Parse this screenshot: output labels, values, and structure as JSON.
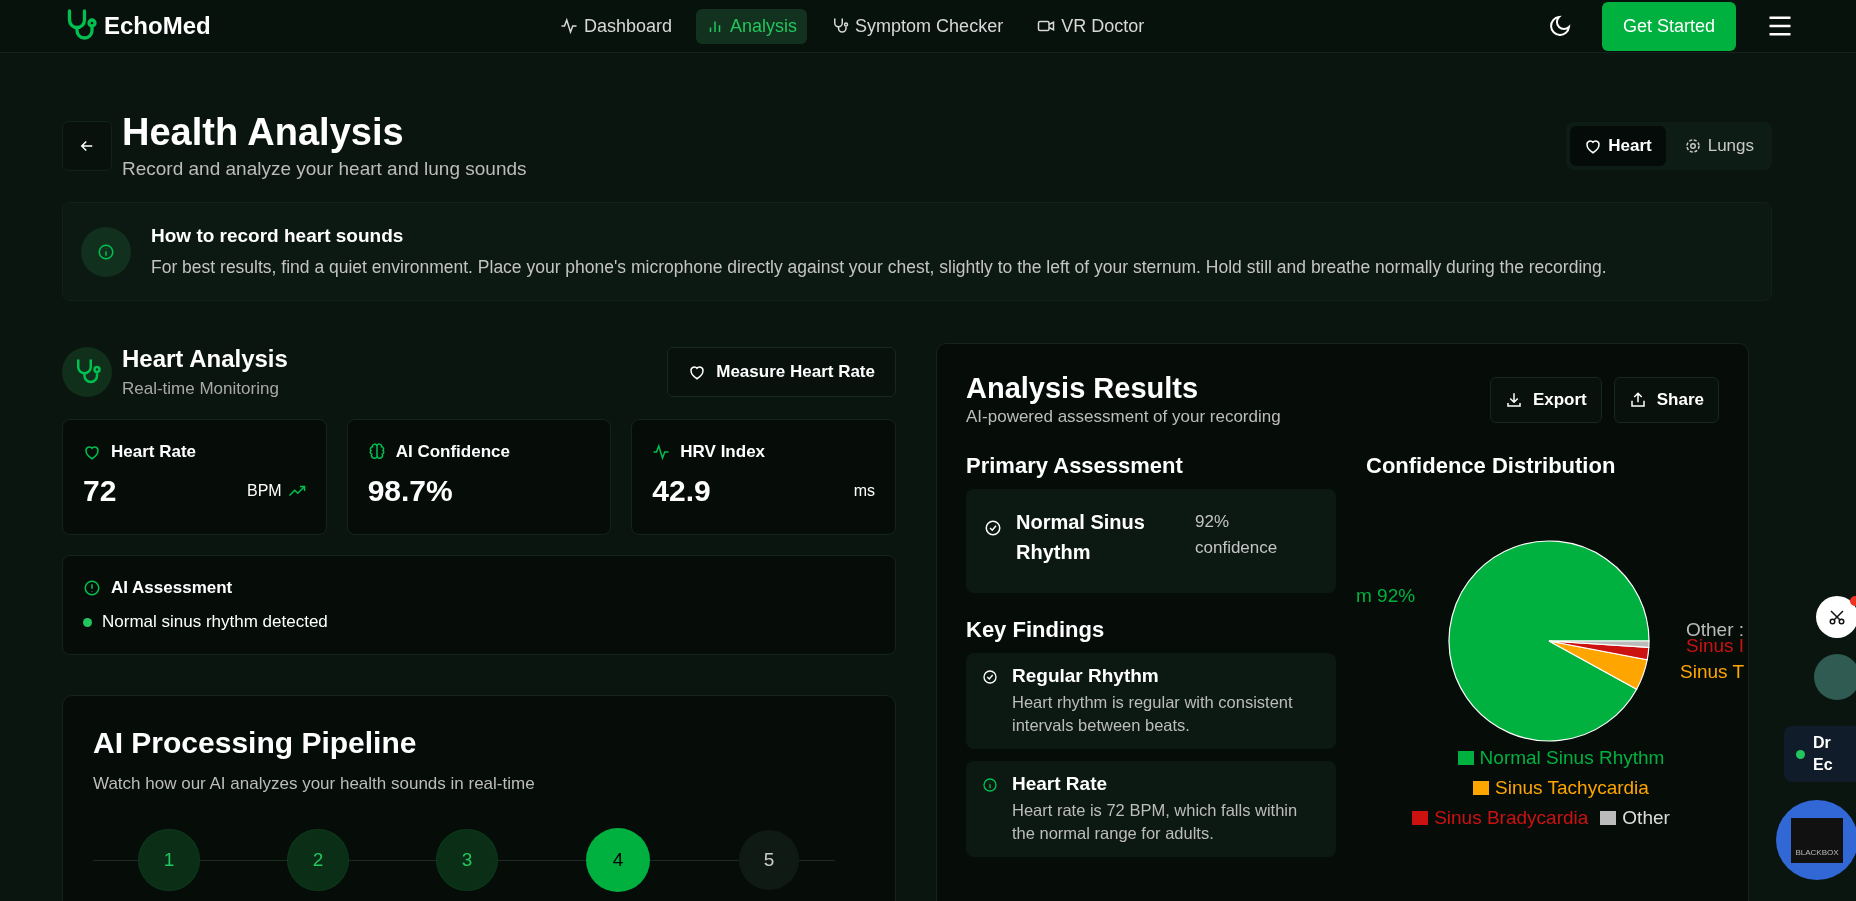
{
  "nav": {
    "brand": "EchoMed",
    "links": [
      {
        "label": "Dashboard",
        "selected": false
      },
      {
        "label": "Analysis",
        "selected": true
      },
      {
        "label": "Symptom Checker",
        "selected": false
      },
      {
        "label": "VR Doctor",
        "selected": false
      }
    ],
    "cta": "Get Started"
  },
  "header": {
    "title": "Health Analysis",
    "subtitle": "Record and analyze your heart and lung sounds",
    "toggle": [
      {
        "label": "Heart",
        "selected": true
      },
      {
        "label": "Lungs",
        "selected": false
      }
    ]
  },
  "info": {
    "title": "How to record heart sounds",
    "text": "For best results, find a quiet environment. Place your phone's microphone directly against your chest, slightly to the left of your sternum. Hold still and breathe normally during the recording."
  },
  "monitor": {
    "title": "Heart Analysis",
    "subtitle": "Real-time Monitoring",
    "button": "Measure Heart Rate",
    "stats": [
      {
        "label": "Heart Rate",
        "value": "72",
        "unit": "BPM",
        "trend": true
      },
      {
        "label": "AI Confidence",
        "value": "98.7%",
        "trend": false
      },
      {
        "label": "HRV Index",
        "value": "42.9",
        "unit": "ms",
        "trend": false
      }
    ],
    "assessment": {
      "title": "AI Assessment",
      "item": "Normal sinus rhythm detected"
    }
  },
  "pipeline": {
    "title": "AI Processing Pipeline",
    "subtitle": "Watch how our AI analyzes your health sounds in real-time",
    "steps": [
      {
        "label": "1",
        "done": true,
        "selected": false
      },
      {
        "label": "2",
        "done": true,
        "selected": false
      },
      {
        "label": "3",
        "done": true,
        "selected": false
      },
      {
        "label": "4",
        "done": false,
        "selected": true
      },
      {
        "label": "5",
        "done": false,
        "selected": false
      }
    ]
  },
  "results": {
    "title": "Analysis Results",
    "subtitle": "AI-powered assessment of your recording",
    "buttons": [
      "Export",
      "Share"
    ],
    "primary": {
      "heading": "Primary Assessment",
      "name": "Normal Sinus Rhythm",
      "confidence": "92% confidence"
    },
    "findings_heading": "Key Findings",
    "findings": [
      {
        "title": "Regular Rhythm",
        "text": "Heart rhythm is regular with consistent intervals between beats."
      },
      {
        "title": "Heart Rate",
        "text": "Heart rate is 72 BPM, which falls within the normal range for adults."
      }
    ],
    "distribution": {
      "heading": "Confidence Distribution",
      "chart_data": {
        "type": "pie",
        "categories": [
          "Normal Sinus Rhythm",
          "Sinus Tachycardia",
          "Sinus Bradycardia",
          "Other"
        ],
        "values": [
          92,
          5,
          2,
          1
        ],
        "colors": [
          "#00b140",
          "#ffa500",
          "#cc1111",
          "#bbbbbb"
        ],
        "legend": "bottom"
      },
      "slice_labels": [
        {
          "text": "m 92%",
          "color": "#00b140"
        },
        {
          "text": "Other :",
          "color": "#bbbbbb"
        },
        {
          "text": "Sinus I",
          "color": "#cc1111"
        },
        {
          "text": "Sinus T",
          "color": "#ffa500"
        }
      ]
    }
  },
  "widgets": {
    "card_lines": [
      "Dr",
      "Ec"
    ],
    "badge_text": "BLACKBOX"
  }
}
